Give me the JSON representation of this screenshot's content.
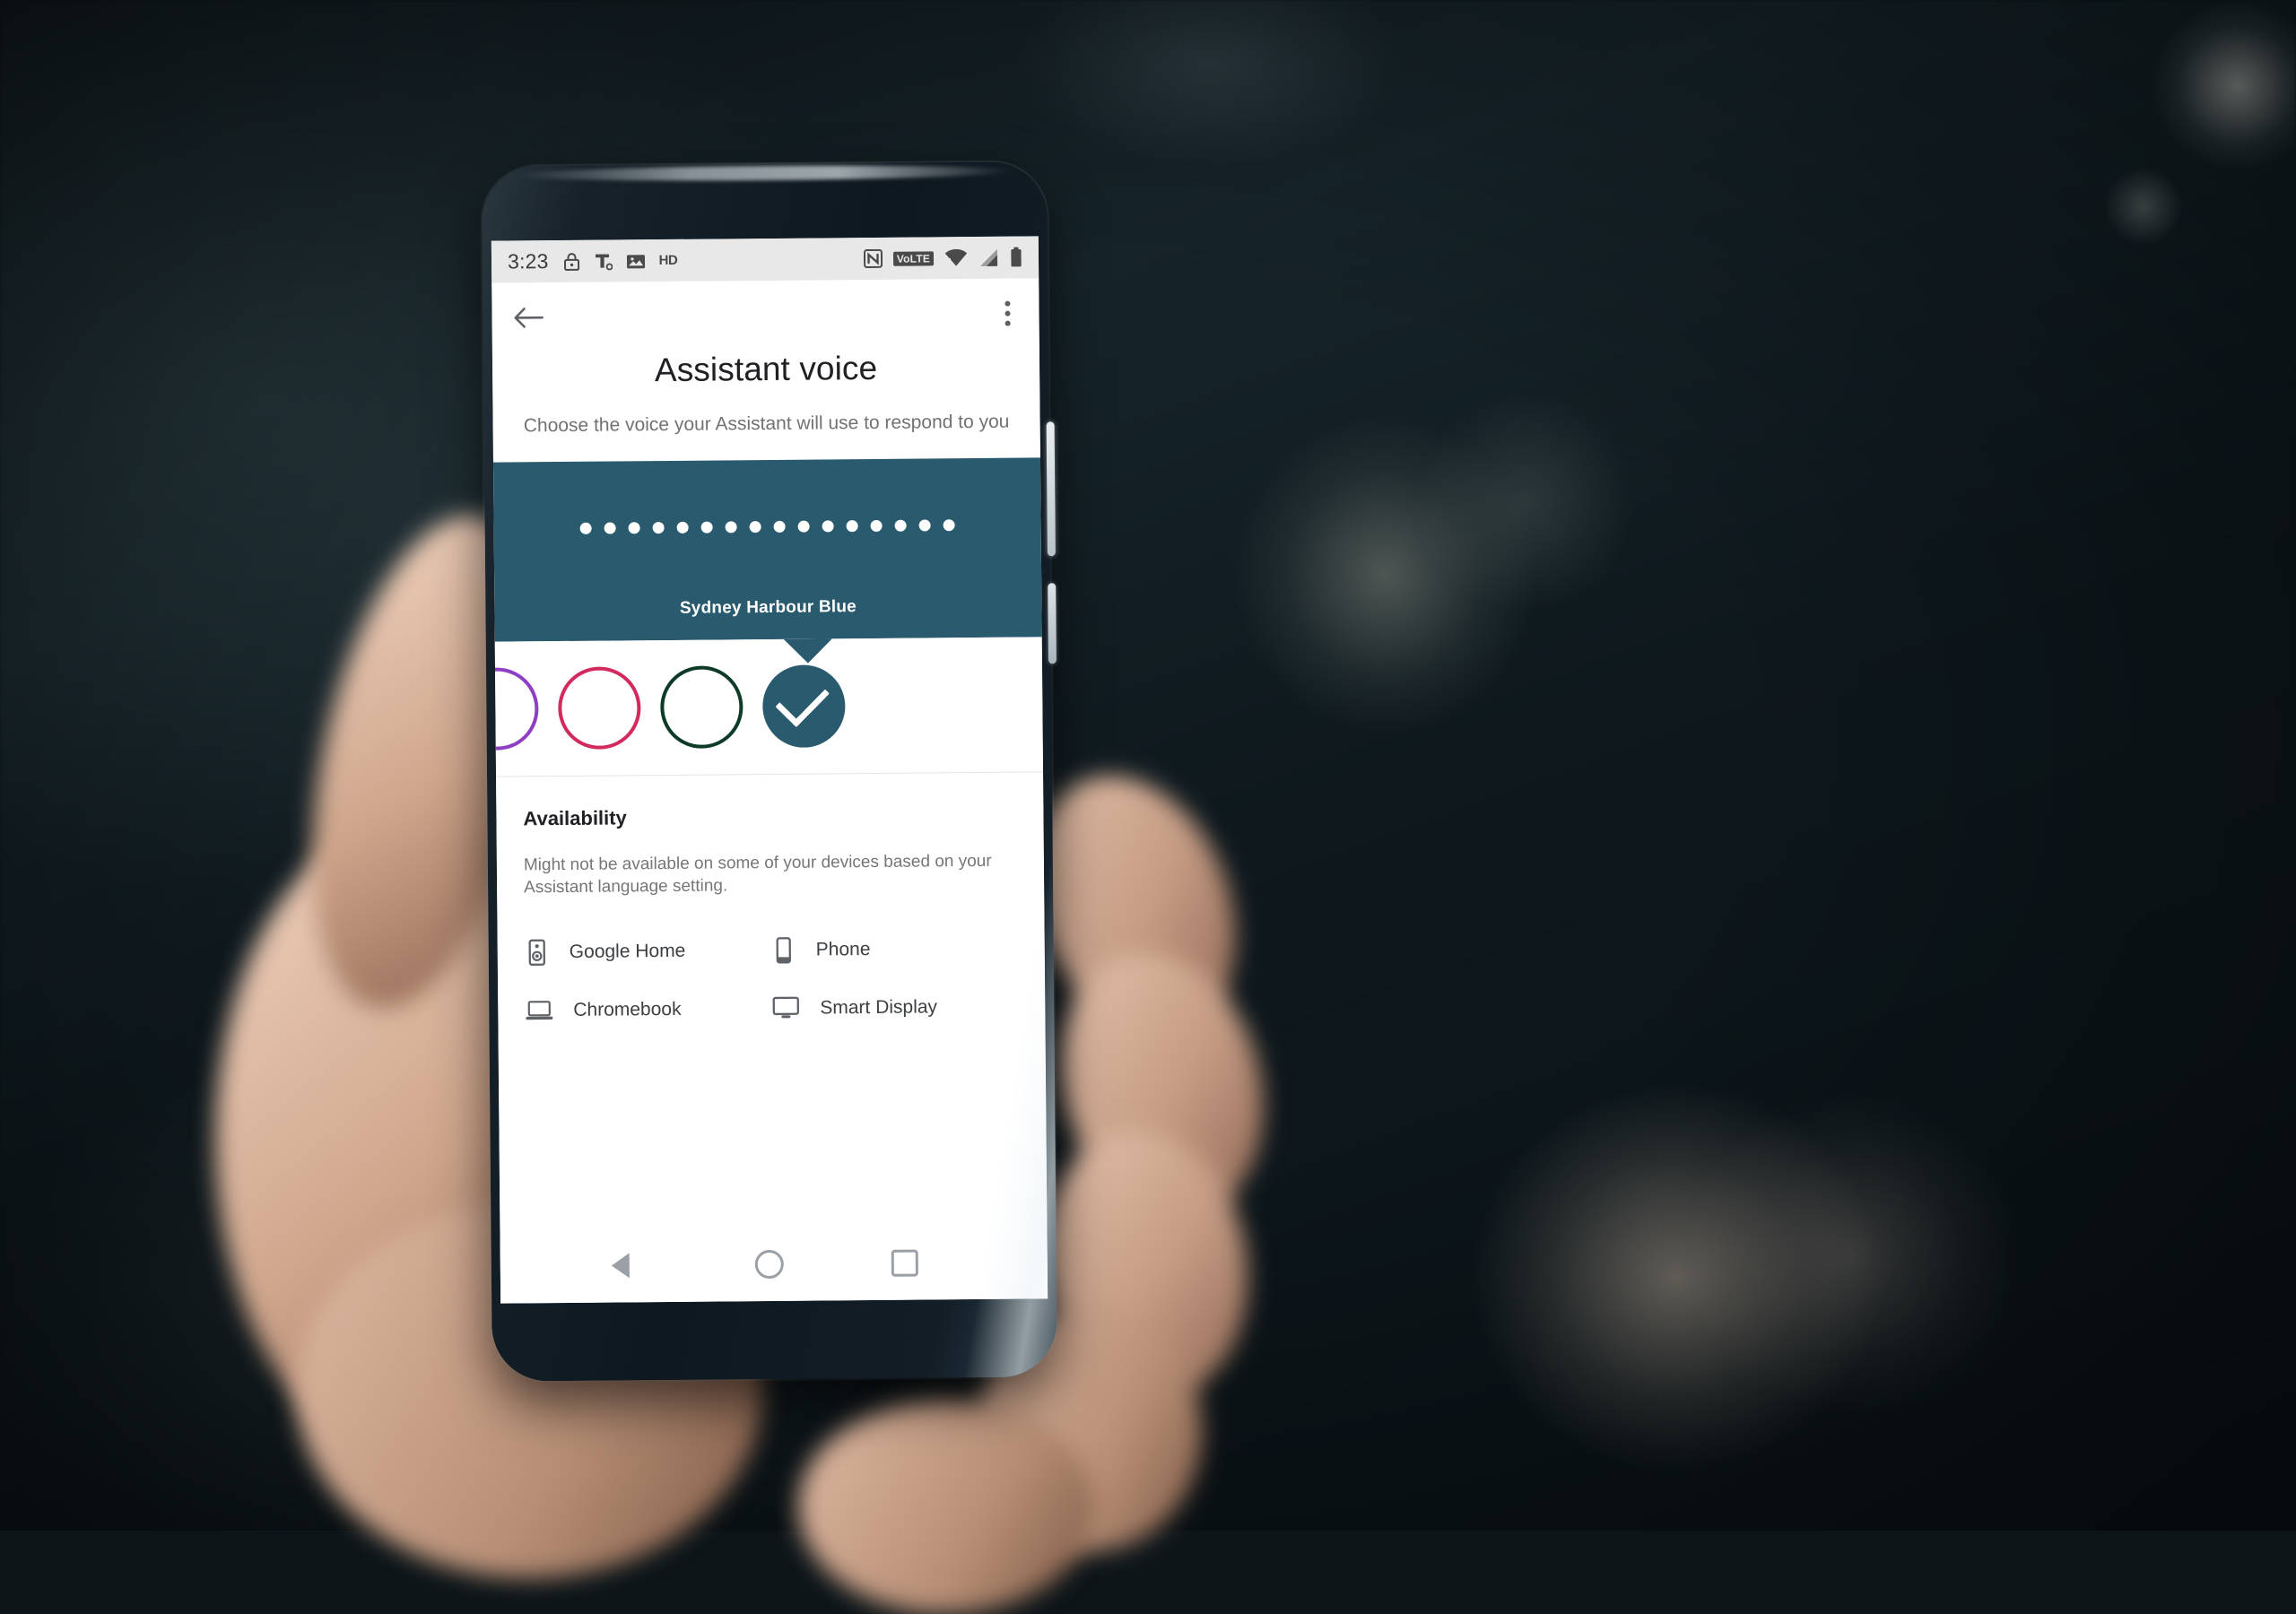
{
  "status_bar": {
    "time": "3:23",
    "left_icons": [
      "lock-icon",
      "tmobile-icon",
      "image-icon"
    ],
    "hd_label": "HD",
    "nfc_label": "N",
    "volte_label": "VoLTE",
    "right_icons": [
      "wifi-icon",
      "signal-icon",
      "battery-icon"
    ]
  },
  "app_bar": {
    "back_label": "Back",
    "overflow_label": "More options"
  },
  "header": {
    "title": "Assistant voice",
    "subtitle": "Choose the voice your Assistant will use to respond to you"
  },
  "voice_panel": {
    "background_color": "#2a5a6e",
    "selected_voice_name": "Sydney Harbour Blue",
    "waveform_dot_count": 16
  },
  "voice_swatches": [
    {
      "name": "purple-voice",
      "color": "#8e3fc4",
      "selected": false,
      "partial": true
    },
    {
      "name": "crimson-voice",
      "color": "#d32a5e",
      "selected": false,
      "partial": false
    },
    {
      "name": "forest-green-voice",
      "color": "#0d3b27",
      "selected": false,
      "partial": false
    },
    {
      "name": "sydney-harbour-blue-voice",
      "color": "#2a5a6e",
      "selected": true,
      "partial": false
    }
  ],
  "availability": {
    "heading": "Availability",
    "description": "Might not be available on some of your devices based on your Assistant language setting.",
    "devices": [
      {
        "label": "Google Home",
        "icon": "speaker-icon"
      },
      {
        "label": "Phone",
        "icon": "phone-icon"
      },
      {
        "label": "Chromebook",
        "icon": "laptop-icon"
      },
      {
        "label": "Smart Display",
        "icon": "monitor-icon"
      }
    ]
  },
  "nav_bar": {
    "back_label": "Back",
    "home_label": "Home",
    "recents_label": "Recent apps"
  }
}
